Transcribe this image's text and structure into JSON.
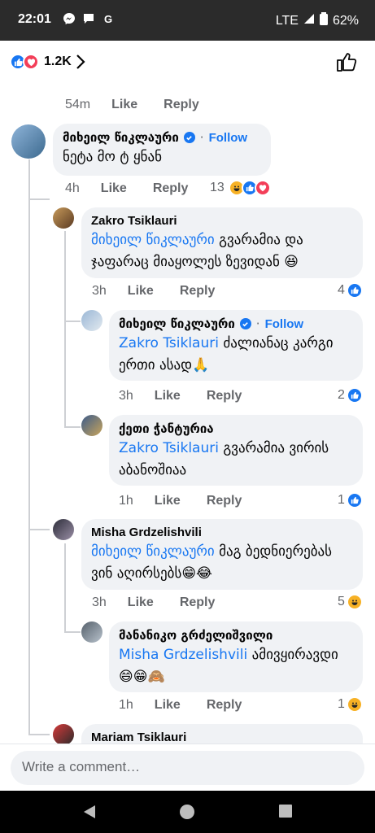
{
  "status_bar": {
    "time": "22:01",
    "network": "LTE",
    "battery": "62%",
    "icons": [
      "messenger-icon",
      "chat-icon",
      "google-icon",
      "signal-icon",
      "battery-icon"
    ]
  },
  "header": {
    "reaction_count": "1.2K",
    "reaction_icons": [
      "like",
      "love"
    ]
  },
  "prev_comment_meta": {
    "time": "54m",
    "like": "Like",
    "reply": "Reply"
  },
  "comments": [
    {
      "author": "მიხეილ წიკლაური",
      "verified": true,
      "follow": "Follow",
      "text": "ნეტა მო ტ ყნან",
      "time": "4h",
      "like": "Like",
      "reply": "Reply",
      "reactions_count": "13",
      "reaction_icons": [
        "haha",
        "like",
        "love"
      ]
    },
    {
      "author": "Zakro Tsiklauri",
      "mention": "მიხეილ წიკლაური",
      "text": " გვარამია და ჯაფარაც მიაყოლეს ზევიდან 😆",
      "time": "3h",
      "like": "Like",
      "reply": "Reply",
      "reactions_count": "4",
      "reaction_icons": [
        "like"
      ]
    },
    {
      "author": "მიხეილ წიკლაური",
      "verified": true,
      "follow": "Follow",
      "mention": "Zakro Tsiklauri",
      "text": " ძალიანაც კარგი ერთი ასად🙏",
      "time": "3h",
      "like": "Like",
      "reply": "Reply",
      "reactions_count": "2",
      "reaction_icons": [
        "like"
      ]
    },
    {
      "author": "ქეთი ჭანტურია",
      "mention": "Zakro Tsiklauri",
      "text": " გვარამია ვირის აბანოშიაა",
      "time": "1h",
      "like": "Like",
      "reply": "Reply",
      "reactions_count": "1",
      "reaction_icons": [
        "like"
      ]
    },
    {
      "author": "Misha Grdzelishvili",
      "mention": "მიხეილ წიკლაური",
      "text": " მაგ ბედნიერებას ვინ აღირსებს😁😂",
      "time": "3h",
      "like": "Like",
      "reply": "Reply",
      "reactions_count": "5",
      "reaction_icons": [
        "haha"
      ]
    },
    {
      "author": "მანანიკო გრძელიშვილი",
      "mention": "Misha Grdzelishvili",
      "text": " ამივყირავდი 😄😁🙈",
      "time": "1h",
      "like": "Like",
      "reply": "Reply",
      "reactions_count": "1",
      "reaction_icons": [
        "haha"
      ]
    },
    {
      "author": "Mariam Tsiklauri"
    }
  ],
  "composer": {
    "placeholder": "Write a comment…"
  },
  "nav": [
    "back-icon",
    "home-icon",
    "recents-icon"
  ],
  "colors": {
    "accent": "#1877f2",
    "bubble": "#f0f2f5",
    "meta": "#65676b",
    "love": "#f33e58",
    "haha": "#f7b125"
  }
}
